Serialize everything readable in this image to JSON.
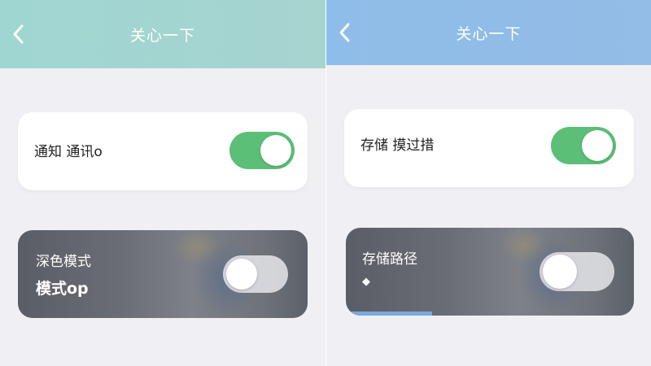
{
  "left_panel": {
    "header": {
      "title": "关心一下"
    },
    "notify_card": {
      "label": "通知 通讯o",
      "toggle_on": true
    },
    "dark_card": {
      "label": "深色模式",
      "sub": "模式op",
      "toggle_on": false
    }
  },
  "right_panel": {
    "header": {
      "title": "关心一下"
    },
    "storage_card": {
      "label": "存储 摸过措",
      "toggle_on": true
    },
    "path_card": {
      "label": "存储路径",
      "sub": "◆",
      "toggle_on": false,
      "progress": 0.3
    }
  },
  "colors": {
    "left_header": "#a0d6d2",
    "right_header": "#8fbde9",
    "toggle_on": "#5cbf77",
    "background": "#f0f0f4"
  },
  "icons": {
    "back": "chevron-left-icon"
  }
}
